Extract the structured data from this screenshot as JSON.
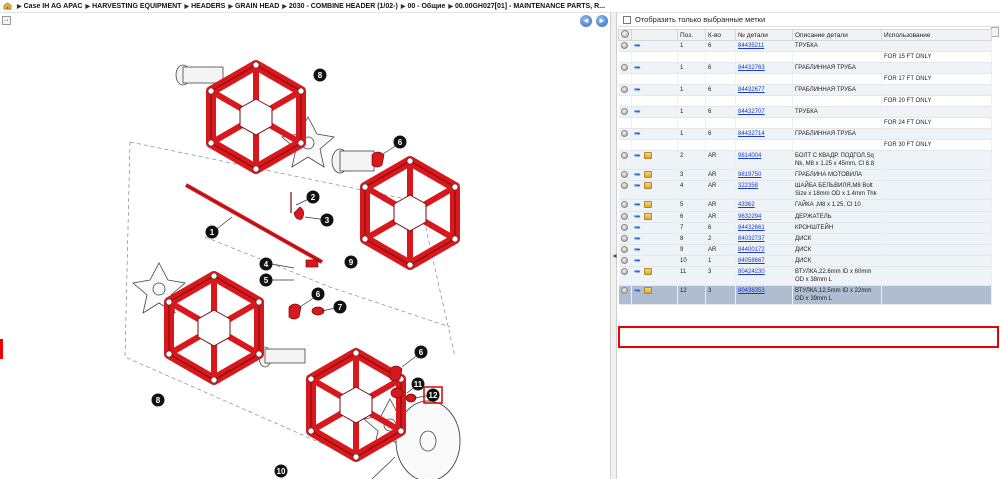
{
  "breadcrumb": [
    "Case IH AG APAC",
    "HARVESTING EQUIPMENT",
    "HEADERS",
    "GRAIN HEAD",
    "2030 - COMBINE HEADER (1/02-)",
    "00 - Общие",
    "00.00GH027[01] - MAINTENANCE PARTS, R..."
  ],
  "nav": {
    "back_glyph": "◄",
    "forward_glyph": "►",
    "toggle_glyph": "→"
  },
  "filter": {
    "label": "Отобразить только выбранные метки"
  },
  "table": {
    "headers": [
      "",
      "",
      "Поз.",
      "К-во",
      "№ детали",
      "Описание детали",
      "Использование"
    ],
    "rows": [
      {
        "kind": "part",
        "pkg": false,
        "pos": "1",
        "qty": "6",
        "part": "84435211",
        "desc": "ТРУБКА",
        "use": ""
      },
      {
        "kind": "note",
        "use": "FOR 15 FT ONLY"
      },
      {
        "kind": "part",
        "pkg": false,
        "pos": "1",
        "qty": "6",
        "part": "84432763",
        "desc": "ГРАБЛИННАЯ ТРУБА",
        "use": ""
      },
      {
        "kind": "note",
        "use": "FOR 17 FT ONLY"
      },
      {
        "kind": "part",
        "pkg": false,
        "pos": "1",
        "qty": "6",
        "part": "84432677",
        "desc": "ГРАБЛИННАЯ ТРУБА",
        "use": ""
      },
      {
        "kind": "note",
        "use": "FOR 20 FT ONLY"
      },
      {
        "kind": "part",
        "pkg": false,
        "pos": "1",
        "qty": "6",
        "part": "84432707",
        "desc": "ТРУБКА",
        "use": ""
      },
      {
        "kind": "note",
        "use": "FOR 24 FT ONLY"
      },
      {
        "kind": "part",
        "pkg": false,
        "pos": "1",
        "qty": "6",
        "part": "84432714",
        "desc": "ГРАБЛИННАЯ ТРУБА",
        "use": ""
      },
      {
        "kind": "note",
        "use": "FOR 30 FT ONLY"
      },
      {
        "kind": "part",
        "pkg": true,
        "pos": "2",
        "qty": "AR",
        "part": "9814004",
        "desc": "БОЛТ С КВАДР. ПОДГОЛ.Sq Nk, M8 x 1.25 x 45mm, Cl 8.8",
        "use": ""
      },
      {
        "kind": "part",
        "pkg": true,
        "pos": "3",
        "qty": "AR",
        "part": "9819750",
        "desc": "ГРАБЛИНА МОТОВИЛА",
        "use": ""
      },
      {
        "kind": "part",
        "pkg": true,
        "pos": "4",
        "qty": "AR",
        "part": "322358",
        "desc": "ШАЙБА БЕЛЬВИЛЯ,M8 Bolt Size x 18mm OD x 1.4mm Thk",
        "use": ""
      },
      {
        "kind": "part",
        "pkg": true,
        "pos": "5",
        "qty": "AR",
        "part": "43362",
        "desc": "ГАЙКА ,M8 x 1.25, Cl 10",
        "use": ""
      },
      {
        "kind": "part",
        "pkg": true,
        "pos": "6",
        "qty": "AR",
        "part": "9632294",
        "desc": "ДЕРЖАТЕЛЬ",
        "use": ""
      },
      {
        "kind": "part",
        "pkg": false,
        "pos": "7",
        "qty": "6",
        "part": "84432661",
        "desc": "КРОНШТЕЙН",
        "use": ""
      },
      {
        "kind": "part",
        "pkg": false,
        "pos": "8",
        "qty": "2",
        "part": "84032737",
        "desc": "ДИСК",
        "use": ""
      },
      {
        "kind": "part",
        "pkg": false,
        "pos": "9",
        "qty": "AR",
        "part": "84400172",
        "desc": "ДИСК",
        "use": ""
      },
      {
        "kind": "part",
        "pkg": false,
        "pos": "10",
        "qty": "1",
        "part": "84058667",
        "desc": "ДИСК",
        "use": ""
      },
      {
        "kind": "part",
        "pkg": true,
        "pos": "11",
        "qty": "3",
        "part": "80424230",
        "desc": "ВТУЛКА,22.6mm ID x 60mm OD x 38mm L",
        "use": ""
      },
      {
        "kind": "part",
        "pkg": true,
        "pos": "12",
        "qty": "3",
        "part": "80436353",
        "desc": "ВТУЛКА,12.5mm ID x 22mm OD x 39mm L",
        "use": "",
        "selected": true
      }
    ]
  },
  "callouts": [
    "1",
    "2",
    "3",
    "4",
    "5",
    "6",
    "6",
    "6",
    "7",
    "8",
    "8",
    "9",
    "10",
    "11",
    "12"
  ],
  "colors": {
    "part_red": "#d8181c",
    "selected_row": "#aebdd2",
    "highlight": "#e00000",
    "link": "#1a3bd6"
  }
}
